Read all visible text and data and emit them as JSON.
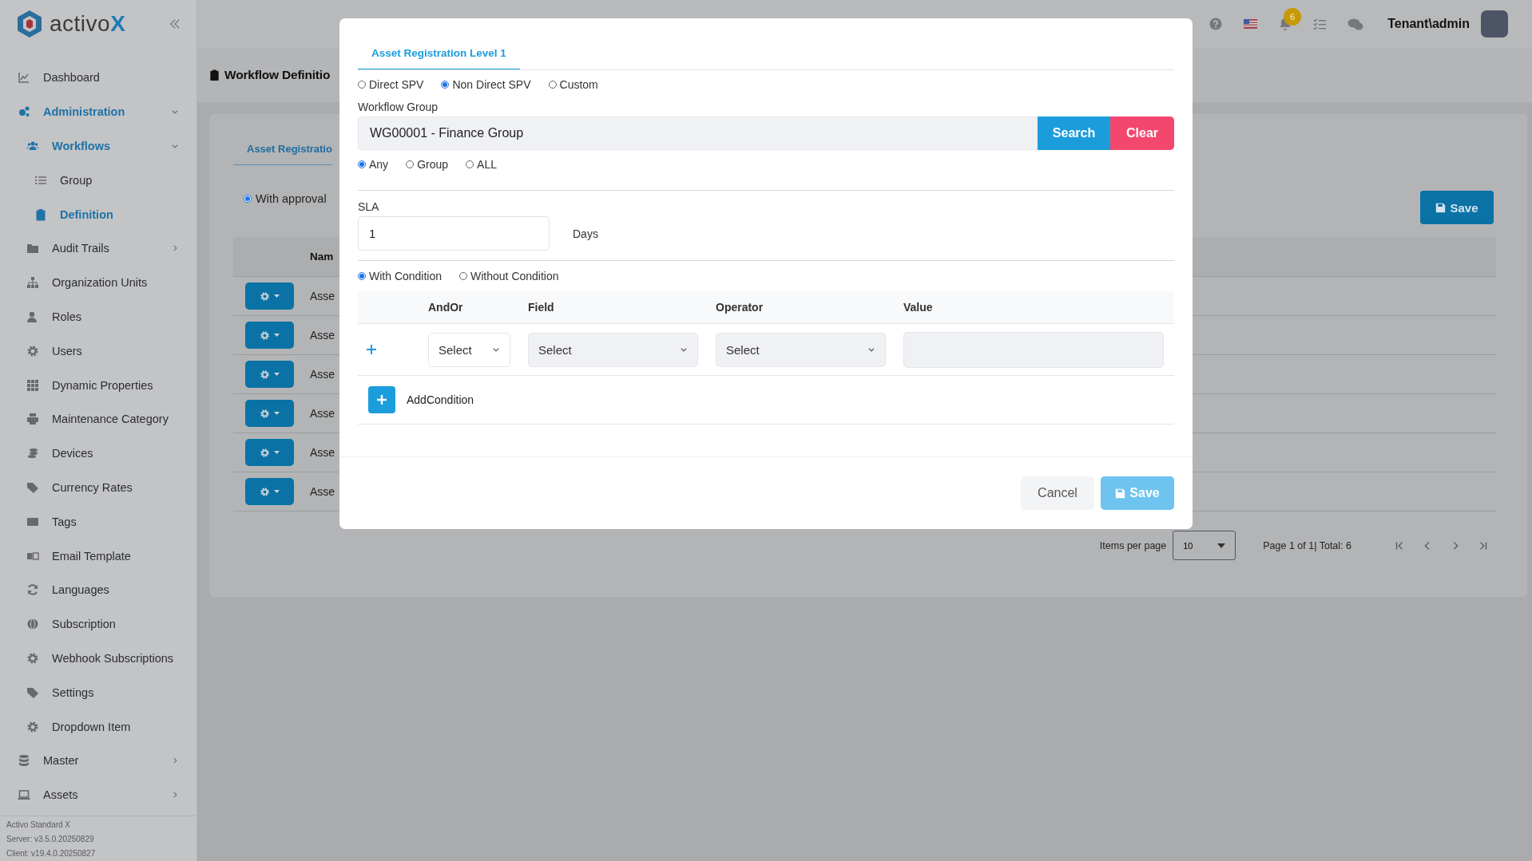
{
  "sidebar": {
    "logo": {
      "name": "activo",
      "accent": "X"
    },
    "items": [
      {
        "label": "Dashboard",
        "active": false
      },
      {
        "label": "Administration",
        "active": true,
        "expanded": true,
        "children": [
          {
            "label": "Workflows",
            "active": true,
            "expanded": true,
            "children": [
              {
                "label": "Group",
                "active": false
              },
              {
                "label": "Definition",
                "active": true
              }
            ]
          },
          {
            "label": "Audit Trails",
            "active": false,
            "expanded": false
          },
          {
            "label": "Organization Units",
            "active": false
          },
          {
            "label": "Roles",
            "active": false
          },
          {
            "label": "Users",
            "active": false
          },
          {
            "label": "Dynamic Properties",
            "active": false
          },
          {
            "label": "Maintenance Category",
            "active": false
          },
          {
            "label": "Devices",
            "active": false
          },
          {
            "label": "Currency Rates",
            "active": false
          },
          {
            "label": "Tags",
            "active": false
          },
          {
            "label": "Email Template",
            "active": false
          },
          {
            "label": "Languages",
            "active": false
          },
          {
            "label": "Subscription",
            "active": false
          },
          {
            "label": "Webhook Subscriptions",
            "active": false
          },
          {
            "label": "Settings",
            "active": false
          },
          {
            "label": "Dropdown Item",
            "active": false
          }
        ]
      },
      {
        "label": "Master",
        "active": false,
        "expanded": false
      },
      {
        "label": "Assets",
        "active": false,
        "expanded": false
      }
    ],
    "footer": [
      "Activo Standard X",
      "Server: v3.5.0.20250829",
      "Client: v19.4.0.20250827"
    ]
  },
  "top_bar": {
    "notification_count": "6",
    "user": "Tenant\\admin"
  },
  "page": {
    "title": "Workflow Definitio",
    "tab": {
      "label": "Asset Registratio",
      "selected": true
    },
    "approval": {
      "label": "With approval",
      "selected": true
    },
    "save": "Save",
    "table": {
      "column_2": "Nam",
      "rows": [
        "Asse",
        "Asse",
        "Asse",
        "Asse",
        "Asse",
        "Asse"
      ]
    },
    "pagination": {
      "label": "Items per page",
      "page_size": "10",
      "summary": "Page 1 of 1| Total: 6"
    }
  },
  "modal": {
    "tab": {
      "label": "Asset Registration Level 1",
      "selected": true
    },
    "spv_options": [
      {
        "label": "Direct SPV",
        "selected": false
      },
      {
        "label": "Non Direct SPV",
        "selected": true
      },
      {
        "label": "Custom",
        "selected": false
      }
    ],
    "workflow_group": {
      "label": "Workflow Group",
      "value": "WG00001 - Finance Group",
      "search": "Search",
      "clear": "Clear"
    },
    "approver_options": [
      {
        "label": "Any",
        "selected": true
      },
      {
        "label": "Group",
        "selected": false
      },
      {
        "label": "ALL",
        "selected": false
      }
    ],
    "sla": {
      "label": "SLA",
      "value": "1",
      "unit": "Days"
    },
    "condition_options": [
      {
        "label": "With Condition",
        "selected": true
      },
      {
        "label": "Without Condition",
        "selected": false
      }
    ],
    "conditions": {
      "columns": [
        "AndOr",
        "Field",
        "Operator",
        "Value"
      ],
      "rows": [
        {
          "and_or": "Select",
          "field": "Select",
          "operator": "Select"
        }
      ]
    },
    "add_condition": "AddCondition",
    "cancel": "Cancel",
    "save": {
      "label": "Save",
      "disabled": true
    }
  }
}
